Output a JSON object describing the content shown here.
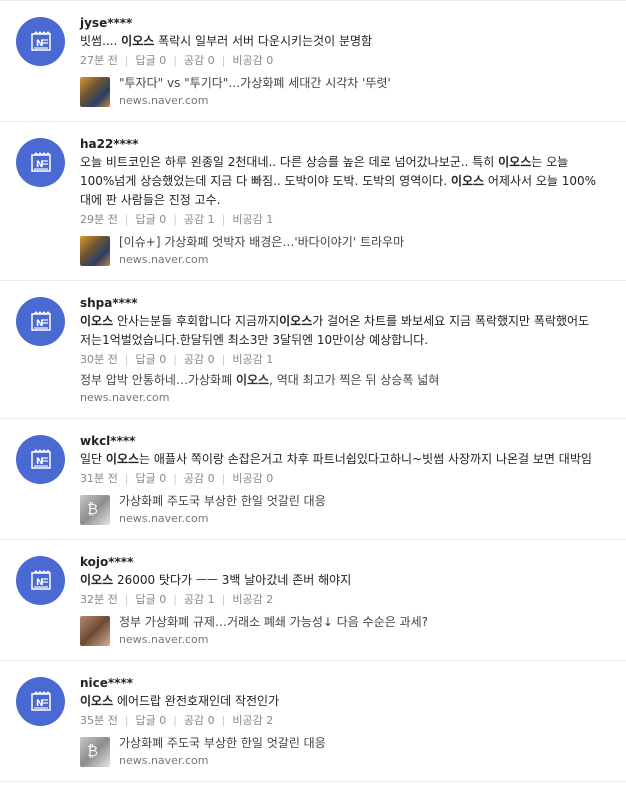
{
  "comments": [
    {
      "nick": "jyse****",
      "text_parts": [
        "빗썸.... ",
        "이오스",
        " 폭락시 일부러 서버 다운시키는것이 분명함"
      ],
      "time": "27분 전",
      "reply": "답글 0",
      "like": "공감 0",
      "dislike": "비공감 0",
      "news_title": [
        "\"투자다\" vs \"투기다\"…가상화폐 세대간 시각차 '뚜렷'",
        "",
        ""
      ],
      "news_source": "news.naver.com",
      "thumb": "t1"
    },
    {
      "nick": "ha22****",
      "text_parts": [
        "오늘 비트코인은 하루 왼종일 2천대네.. 다른 상승를 높은 데로 넘어갔나보군.. 특히 ",
        "이오스",
        "는 오늘 100%넘게 상승했었는데 지금 다 빠짐.. 도박이야 도박. 도박의 영역이다. ",
        "이오스",
        " 어제사서 오늘 100%대에 판 사람들은 진정 고수."
      ],
      "time": "29분 전",
      "reply": "답글 0",
      "like": "공감 1",
      "dislike": "비공감 1",
      "news_title": [
        "[이슈+] 가상화폐 엇박자 배경은…'바다이야기' 트라우마",
        "",
        ""
      ],
      "news_source": "news.naver.com",
      "thumb": "t1"
    },
    {
      "nick": "shpa****",
      "text_parts": [
        "",
        "이오스",
        " 안사는분들 후회합니다 지금까지",
        "이오스",
        "가 걸어온 차트를 봐보세요 지금 폭락했지만 폭락했어도 저는1억벌었습니다.한달뒤엔 최소3만 3달뒤엔 10만이상 예상합니다."
      ],
      "time": "30분 전",
      "reply": "답글 0",
      "like": "공감 0",
      "dislike": "비공감 1",
      "news_title": [
        "정부 압박 안통하네…가상화폐 ",
        "이오스",
        ", 역대 최고가 찍은 뒤 상승폭 넓혀"
      ],
      "news_source": "news.naver.com",
      "thumb": ""
    },
    {
      "nick": "wkcl****",
      "text_parts": [
        "일단 ",
        "이오스",
        "는 애플사 쪽이랑 손잡은거고 차후 파트너쉽있다고하니~빗썸 사장까지 나온걸 보면 대박임"
      ],
      "time": "31분 전",
      "reply": "답글 0",
      "like": "공감 0",
      "dislike": "비공감 0",
      "news_title": [
        "가상화폐 주도국 부상한 한일 엇갈린 대응",
        "",
        ""
      ],
      "news_source": "news.naver.com",
      "thumb": "t2"
    },
    {
      "nick": "kojo****",
      "text_parts": [
        "",
        "이오스",
        " 26000 탓다가 ㅡㅡ 3백 날아갔네 존버 해야지"
      ],
      "time": "32분 전",
      "reply": "답글 0",
      "like": "공감 1",
      "dislike": "비공감 2",
      "news_title": [
        "정부 가상화폐 규제…거래소 폐쇄 가능성↓ 다음 수순은 과세?",
        "",
        ""
      ],
      "news_source": "news.naver.com",
      "thumb": "t3"
    },
    {
      "nick": "nice****",
      "text_parts": [
        "",
        "이오스",
        " 에어드랍 완전호재인데 작전인가"
      ],
      "time": "35분 전",
      "reply": "답글 0",
      "like": "공감 0",
      "dislike": "비공감 2",
      "news_title": [
        "가상화폐 주도국 부상한 한일 엇갈린 대응",
        "",
        ""
      ],
      "news_source": "news.naver.com",
      "thumb": "t2"
    }
  ]
}
